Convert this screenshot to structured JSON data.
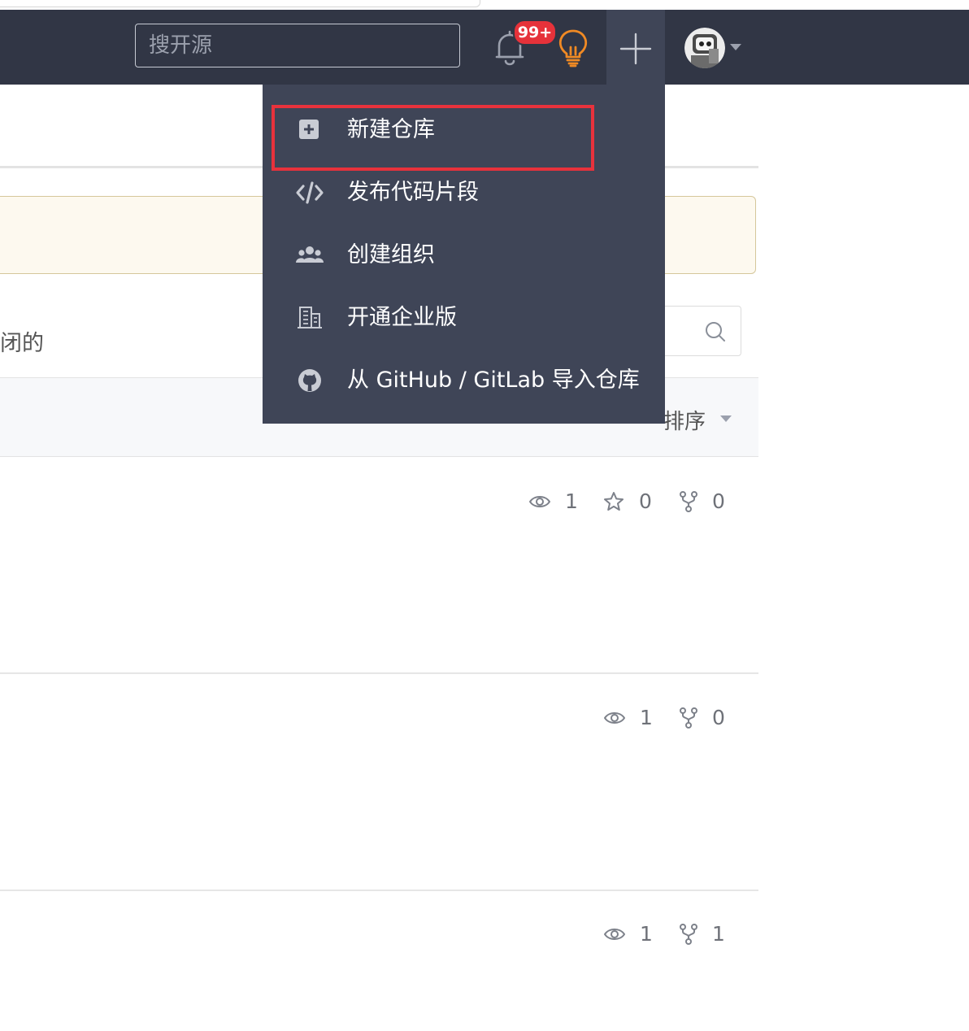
{
  "navbar": {
    "search_placeholder": "搜开源",
    "notification_badge": "99+",
    "icons": [
      "bell-icon",
      "lightbulb-icon",
      "plus-icon",
      "avatar",
      "caret-down-icon"
    ]
  },
  "dropdown": {
    "items": [
      {
        "label": "新建仓库",
        "icon": "plus-square-icon"
      },
      {
        "label": "发布代码片段",
        "icon": "code-icon"
      },
      {
        "label": "创建组织",
        "icon": "users-icon"
      },
      {
        "label": "开通企业版",
        "icon": "building-icon"
      },
      {
        "label": "从 GitHub / GitLab 导入仓库",
        "icon": "github-icon"
      }
    ]
  },
  "page": {
    "filter_text": "闭的",
    "sort_label": "排序"
  },
  "repos": [
    {
      "watch": "1",
      "star": "0",
      "fork": "0"
    },
    {
      "watch": "1",
      "fork": "0"
    },
    {
      "watch": "1",
      "fork": "1"
    }
  ],
  "colors": {
    "navbar": "#313645",
    "dropdown": "#3f4557",
    "highlight": "#e8323c",
    "badge": "#e6323a",
    "bulb": "#f08a24"
  }
}
